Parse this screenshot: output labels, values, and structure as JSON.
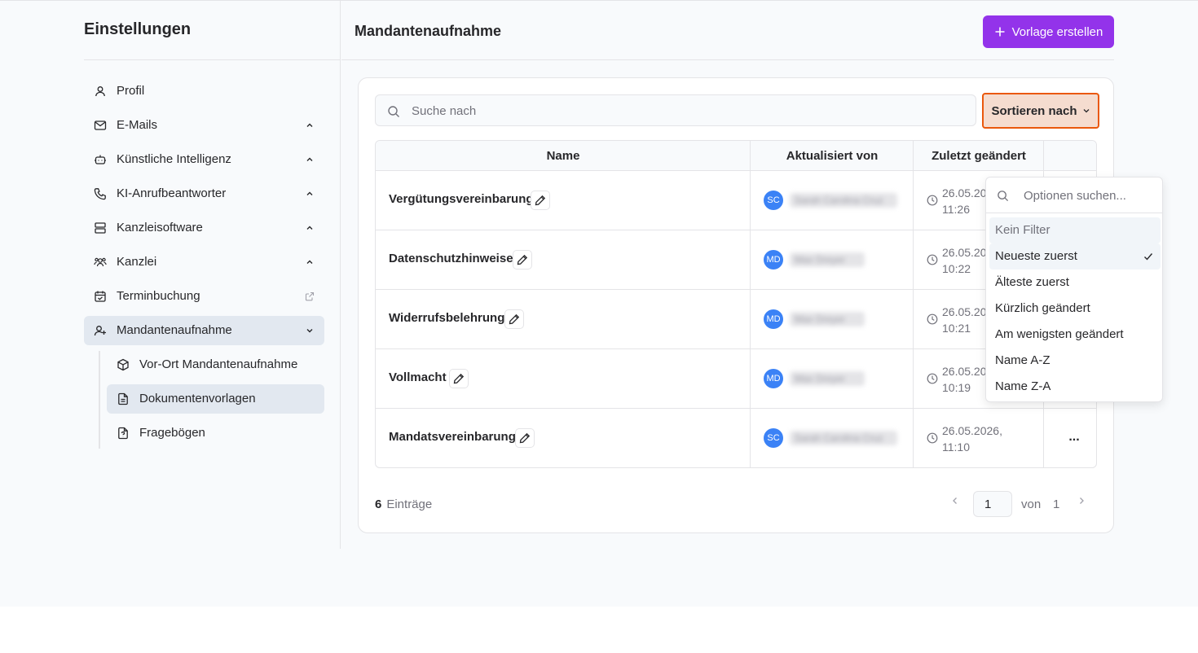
{
  "sidebar": {
    "title": "Einstellungen",
    "items": [
      {
        "label": "Profil"
      },
      {
        "label": "E-Mails"
      },
      {
        "label": "Künstliche Intelligenz"
      },
      {
        "label": "KI-Anrufbeantworter"
      },
      {
        "label": "Kanzleisoftware"
      },
      {
        "label": "Kanzlei"
      },
      {
        "label": "Terminbuchung"
      },
      {
        "label": "Mandantenaufnahme"
      }
    ],
    "subitems": [
      {
        "label": "Vor-Ort Mandantenaufnahme"
      },
      {
        "label": "Dokumentenvorlagen"
      },
      {
        "label": "Fragebögen"
      }
    ]
  },
  "header": {
    "title": "Mandantenaufnahme",
    "create_label": "Vorlage erstellen"
  },
  "search": {
    "placeholder": "Suche nach"
  },
  "sort": {
    "label": "Sortieren nach"
  },
  "table": {
    "columns": [
      "Name",
      "Aktualisiert von",
      "Zuletzt geändert",
      ""
    ],
    "rows": [
      {
        "name": "Vergütungsvereinbarung",
        "initials": "SC",
        "user": "Sarah Carolina Cruz",
        "date": "26.05.20",
        "time": "11:26"
      },
      {
        "name": "Datenschutzhinweise",
        "initials": "MD",
        "user": "Max Dreyer",
        "date": "26.05.20",
        "time": "10:22"
      },
      {
        "name": "Widerrufsbelehrung",
        "initials": "MD",
        "user": "Max Dreyer",
        "date": "26.05.20",
        "time": "10:21"
      },
      {
        "name": "Vollmacht",
        "initials": "MD",
        "user": "Max Dreyer",
        "date": "26.05.20",
        "time": "10:19"
      },
      {
        "name": "Mandatsvereinbarung",
        "initials": "SC",
        "user": "Sarah Carolina Cruz",
        "date": "26.05.2026,",
        "time": "11:10"
      }
    ],
    "more_label": "..."
  },
  "footer": {
    "count": "6",
    "count_label": "Einträge",
    "page": "1",
    "von": "von",
    "total_pages": "1"
  },
  "dropdown": {
    "search_placeholder": "Optionen suchen...",
    "options": [
      {
        "label": "Kein Filter"
      },
      {
        "label": "Neueste zuerst"
      },
      {
        "label": "Älteste zuerst"
      },
      {
        "label": "Kürzlich geändert"
      },
      {
        "label": "Am wenigsten geändert"
      },
      {
        "label": "Name A-Z"
      },
      {
        "label": "Name Z-A"
      }
    ],
    "selected": "Neueste zuerst"
  },
  "colors": {
    "accent": "#9333ea",
    "sort_highlight": "#f5dccf",
    "sort_border": "#ea580c",
    "avatar": "#3b82f6"
  }
}
